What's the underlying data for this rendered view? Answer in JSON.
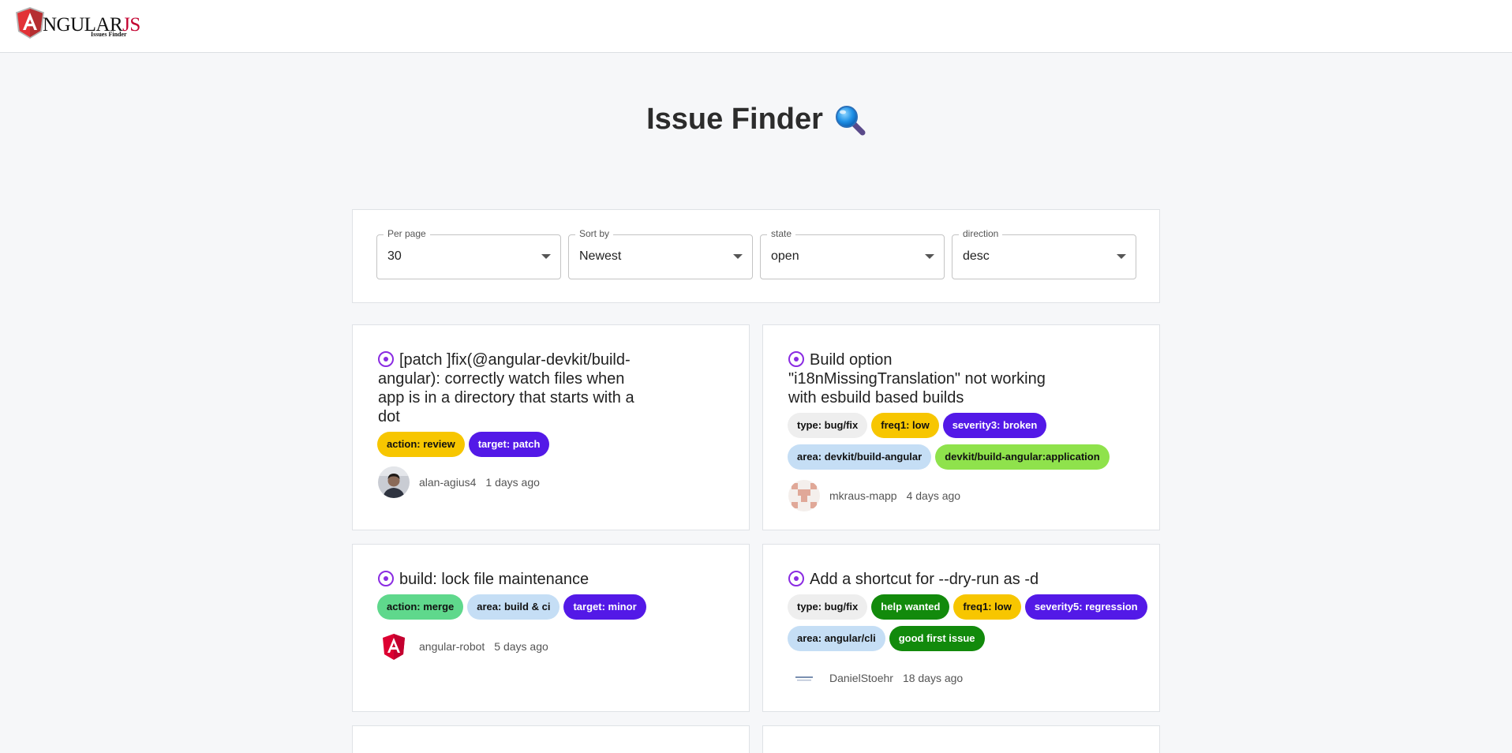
{
  "brand": {
    "logo_letter": "A",
    "logo_word": "NGULAR",
    "logo_js": "JS",
    "logo_sub": "Issues Finder"
  },
  "page": {
    "title": "Issue Finder",
    "title_icon": "magnifier-icon"
  },
  "filters": [
    {
      "label": "Per page",
      "value": "30"
    },
    {
      "label": "Sort by",
      "value": "Newest"
    },
    {
      "label": "state",
      "value": "open"
    },
    {
      "label": "direction",
      "value": "desc"
    }
  ],
  "issues": [
    {
      "title": "[patch ]fix(@angular-devkit/build-angular): correctly watch files when app is in a directory that starts with a dot",
      "labels": [
        {
          "text": "action: review",
          "bg": "#f7c600",
          "fg": "#111111"
        },
        {
          "text": "target: patch",
          "bg": "#5319e7",
          "fg": "#ffffff"
        }
      ],
      "author": "alan-agius4",
      "time": "1 days ago"
    },
    {
      "title": "Build option \"i18nMissingTranslation\" not working with esbuild based builds",
      "labels": [
        {
          "text": "type: bug/fix",
          "bg": "#eeeeee",
          "fg": "#111111"
        },
        {
          "text": "freq1: low",
          "bg": "#f7c600",
          "fg": "#111111"
        },
        {
          "text": "severity3: broken",
          "bg": "#5319e7",
          "fg": "#ffffff"
        },
        {
          "text": "area: devkit/build-angular",
          "bg": "#c5def5",
          "fg": "#111111"
        },
        {
          "text": "devkit/build-angular:application",
          "bg": "#8fe24c",
          "fg": "#111111"
        }
      ],
      "author": "mkraus-mapp",
      "time": "4 days ago"
    },
    {
      "title": "build: lock file maintenance",
      "labels": [
        {
          "text": "action: merge",
          "bg": "#5fd88c",
          "fg": "#111111"
        },
        {
          "text": "area: build & ci",
          "bg": "#c5def5",
          "fg": "#111111"
        },
        {
          "text": "target: minor",
          "bg": "#5319e7",
          "fg": "#ffffff"
        }
      ],
      "author": "angular-robot",
      "time": "5 days ago"
    },
    {
      "title": "Add a shortcut for --dry-run as -d",
      "labels": [
        {
          "text": "type: bug/fix",
          "bg": "#eeeeee",
          "fg": "#111111"
        },
        {
          "text": "help wanted",
          "bg": "#128a0c",
          "fg": "#ffffff"
        },
        {
          "text": "freq1: low",
          "bg": "#f7c600",
          "fg": "#111111"
        },
        {
          "text": "severity5: regression",
          "bg": "#5319e7",
          "fg": "#ffffff"
        },
        {
          "text": "area: angular/cli",
          "bg": "#c5def5",
          "fg": "#111111"
        },
        {
          "text": "good first issue",
          "bg": "#128a0c",
          "fg": "#ffffff"
        }
      ],
      "author": "DanielStoehr",
      "time": "18 days ago"
    }
  ]
}
